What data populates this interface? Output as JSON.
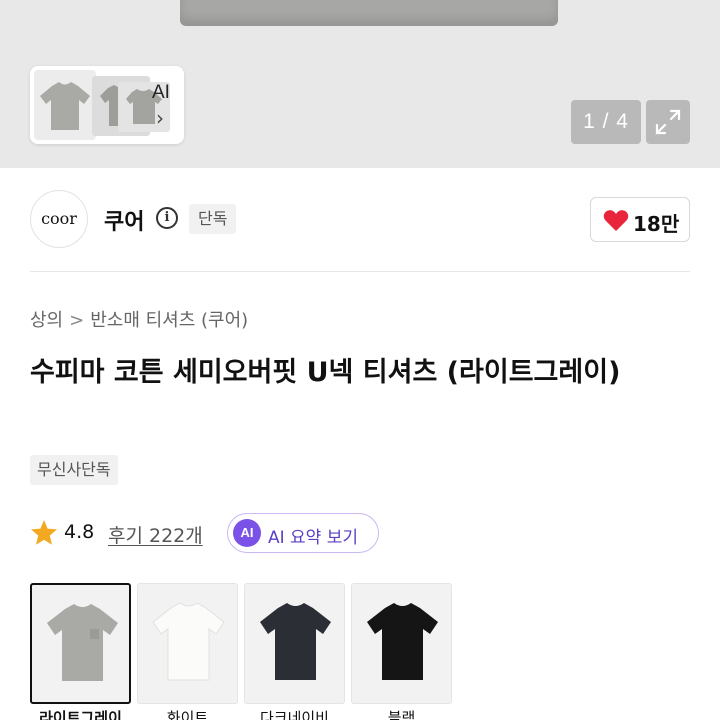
{
  "gallery": {
    "thumb_ai_label": "AI",
    "counter": "1 / 4"
  },
  "brand": {
    "logo_text": "coor",
    "name": "쿠어",
    "exclusive_badge": "단독",
    "like_count": "18만"
  },
  "breadcrumb": {
    "category": "상의",
    "separator": ">",
    "subcategory": "반소매 티셔츠 (쿠어)"
  },
  "product": {
    "title": "수피마 코튼 세미오버핏 U넥 티셔츠 (라이트그레이)",
    "store_badge": "무신사단독",
    "rating": "4.8",
    "reviews": "후기 222개",
    "ai_badge": "AI",
    "ai_summary_label": "AI 요약 보기"
  },
  "colors": [
    {
      "label": "라이트그레이",
      "fill": "#a9a9a6"
    },
    {
      "label": "화이트",
      "fill": "#f4f4f2"
    },
    {
      "label": "다크네이비",
      "fill": "#2b2e34"
    },
    {
      "label": "블랙",
      "fill": "#151515"
    }
  ],
  "accent": {
    "heart": "#e8253b",
    "star": "#f4a821",
    "ai_purple": "#7a52e8"
  }
}
